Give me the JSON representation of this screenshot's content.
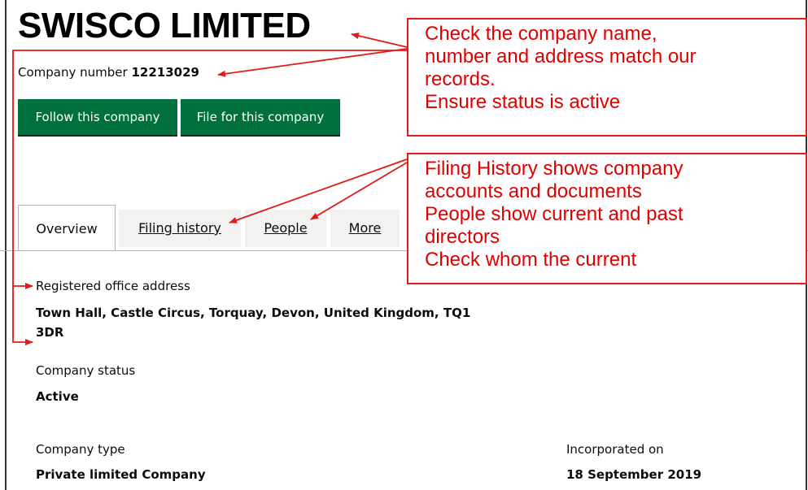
{
  "company": {
    "name": "SWISCO LIMITED",
    "number_label": "Company number",
    "number": "12213029"
  },
  "buttons": {
    "follow": "Follow this company",
    "file": "File for this company"
  },
  "tabs": [
    {
      "label": "Overview",
      "active": true
    },
    {
      "label": "Filing history",
      "active": false
    },
    {
      "label": "People",
      "active": false
    },
    {
      "label": "More",
      "active": false
    }
  ],
  "details": {
    "office_label": "Registered office address",
    "office_line1": "Town Hall, Castle Circus, Torquay, Devon, United Kingdom, TQ1",
    "office_line2": "3DR",
    "status_label": "Company status",
    "status_value": "Active",
    "type_label": "Company type",
    "type_value": "Private limited Company",
    "incorporated_label": "Incorporated on",
    "incorporated_value": "18 September 2019"
  },
  "annotations": {
    "box1": [
      "Check the company name,",
      "number and address match our",
      "records.",
      "Ensure status is active"
    ],
    "box2": [
      "Filing History shows company",
      "accounts and documents",
      "People show current and past",
      "directors",
      "Check whom the current"
    ]
  },
  "colors": {
    "button_green": "#00703c",
    "annotation_red": "#e00000",
    "tab_grey": "#f3f2f1"
  }
}
